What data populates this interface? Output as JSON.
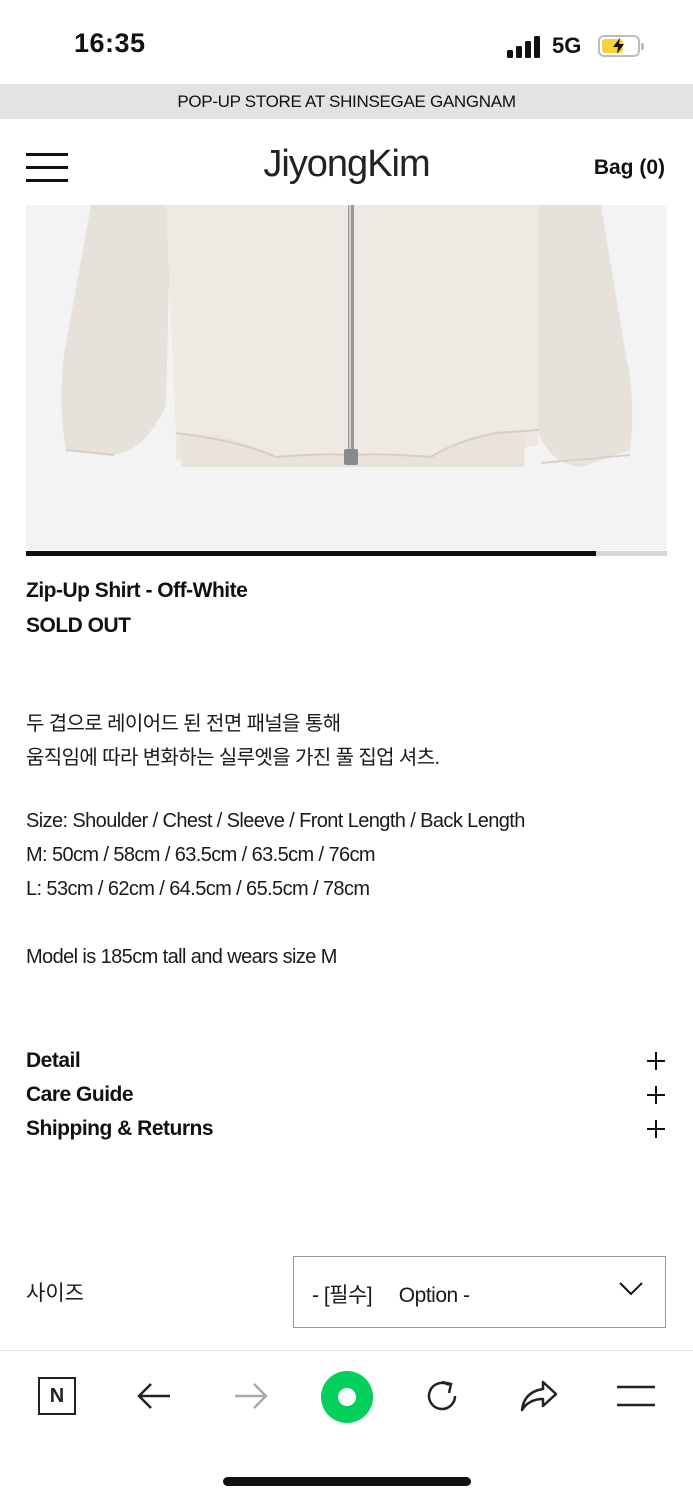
{
  "status_bar": {
    "time": "16:35",
    "network": "5G",
    "icons": [
      "signal-icon",
      "battery-charging-icon"
    ]
  },
  "promo_banner": {
    "text": "POP-UP STORE AT SHINSEGAE GANGNAM"
  },
  "header": {
    "brand": "JiyongKim",
    "bag_label": "Bag (0)",
    "icons": [
      "hamburger-menu-icon"
    ]
  },
  "gallery": {
    "progress": 0.89
  },
  "product": {
    "title": "Zip-Up Shirt - Off-White",
    "status": "SOLD OUT",
    "description_lines": [
      "두 겹으로 레이어드 된 전면 패널을 통해",
      "움직임에 따라 변화하는 실루엣을 가진 풀 집업 셔츠.",
      "Size: Shoulder / Chest / Sleeve / Front Length / Back Length",
      "M: 50cm / 58cm / 63.5cm / 63.5cm / 76cm",
      "L: 53cm / 62cm / 64.5cm / 65.5cm / 78cm",
      "Model is 185cm tall and wears size M"
    ]
  },
  "accordion": [
    {
      "label": "Detail"
    },
    {
      "label": "Care Guide"
    },
    {
      "label": "Shipping & Returns"
    }
  ],
  "options": {
    "size_label": "사이즈",
    "selected": "- [필수]     Option -"
  },
  "browser_toolbar": {
    "n_label": "N",
    "icons": [
      "naver-n-icon",
      "back-arrow-icon",
      "forward-arrow-icon",
      "home-icon",
      "refresh-icon",
      "share-icon",
      "menu-icon"
    ],
    "accent_color": "#03cf5d"
  }
}
